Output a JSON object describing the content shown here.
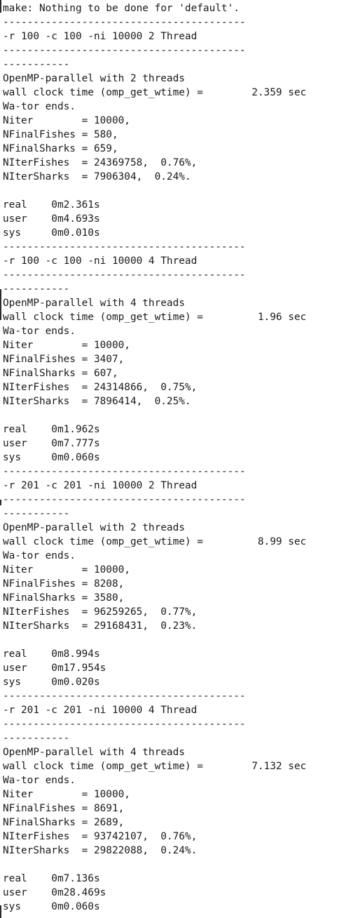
{
  "terminal": {
    "lines": [
      "make: Nothing to be done for 'default'.",
      "----------------------------------------",
      "-r 100 -c 100 -ni 10000 2 Thread",
      "----------------------------------------",
      "-----------",
      "OpenMP-parallel with 2 threads",
      "wall clock time (omp_get_wtime) =        2.359 sec",
      "Wa-tor ends.",
      "Niter        = 10000,",
      "NFinalFishes = 580,",
      "NFinalSharks = 659,",
      "NIterFishes  = 24369758,  0.76%,",
      "NIterSharks  = 7906304,  0.24%.",
      "",
      "real    0m2.361s",
      "user    0m4.693s",
      "sys     0m0.010s",
      "----------------------------------------",
      "-r 100 -c 100 -ni 10000 4 Thread",
      "----------------------------------------",
      "-----------",
      "OpenMP-parallel with 4 threads",
      "wall clock time (omp_get_wtime) =         1.96 sec",
      "Wa-tor ends.",
      "Niter        = 10000,",
      "NFinalFishes = 3407,",
      "NFinalSharks = 607,",
      "NIterFishes  = 24314866,  0.75%,",
      "NIterSharks  = 7896414,  0.25%.",
      "",
      "real    0m1.962s",
      "user    0m7.777s",
      "sys     0m0.060s",
      "----------------------------------------",
      "-r 201 -c 201 -ni 10000 2 Thread",
      "----------------------------------------",
      "-----------",
      "OpenMP-parallel with 2 threads",
      "wall clock time (omp_get_wtime) =         8.99 sec",
      "Wa-tor ends.",
      "Niter        = 10000,",
      "NFinalFishes = 8208,",
      "NFinalSharks = 3580,",
      "NIterFishes  = 96259265,  0.77%,",
      "NIterSharks  = 29168431,  0.23%.",
      "",
      "real    0m8.994s",
      "user    0m17.954s",
      "sys     0m0.020s",
      "----------------------------------------",
      "-r 201 -c 201 -ni 10000 4 Thread",
      "----------------------------------------",
      "-----------",
      "OpenMP-parallel with 4 threads",
      "wall clock time (omp_get_wtime) =        7.132 sec",
      "Wa-tor ends.",
      "Niter        = 10000,",
      "NFinalFishes = 8691,",
      "NFinalSharks = 2689,",
      "NIterFishes  = 93742107,  0.76%,",
      "NIterSharks  = 29822088,  0.24%.",
      "",
      "real    0m7.136s",
      "user    0m28.469s",
      "sys     0m0.060s"
    ]
  },
  "colors": {
    "background": "#ffffff",
    "text": "#1a1a1a",
    "cut_prompt": "#2a6fb0"
  }
}
